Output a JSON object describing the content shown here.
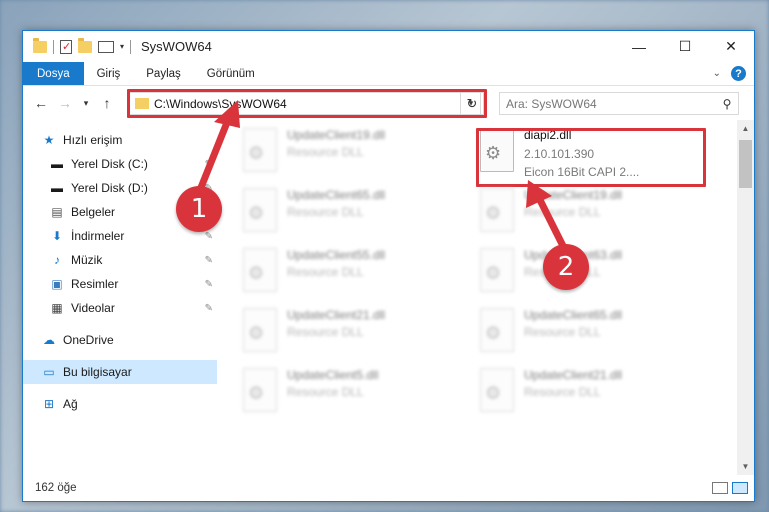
{
  "window": {
    "title": "SysWOW64",
    "controls": {
      "minimize": "—",
      "maximize": "☐",
      "close": "✕"
    }
  },
  "ribbon": {
    "tabs": [
      "Dosya",
      "Giriş",
      "Paylaş",
      "Görünüm"
    ],
    "active_tab": "Dosya"
  },
  "navigation": {
    "address_path": "C:\\Windows\\SysWOW64",
    "search_placeholder": "Ara: SysWOW64"
  },
  "sidebar": {
    "items": [
      {
        "label": "Hızlı erişim",
        "icon": "star-icon",
        "pinned": false
      },
      {
        "label": "Yerel Disk (C:)",
        "icon": "drive-icon",
        "pinned": true
      },
      {
        "label": "Yerel Disk (D:)",
        "icon": "drive-icon",
        "pinned": true
      },
      {
        "label": "Belgeler",
        "icon": "documents-icon",
        "pinned": true
      },
      {
        "label": "İndirmeler",
        "icon": "download-icon",
        "pinned": true
      },
      {
        "label": "Müzik",
        "icon": "music-icon",
        "pinned": true
      },
      {
        "label": "Resimler",
        "icon": "pictures-icon",
        "pinned": true
      },
      {
        "label": "Videolar",
        "icon": "video-icon",
        "pinned": true
      },
      {
        "label": "OneDrive",
        "icon": "cloud-icon",
        "pinned": false
      },
      {
        "label": "Bu bilgisayar",
        "icon": "computer-icon",
        "pinned": false,
        "selected": true
      },
      {
        "label": "Ağ",
        "icon": "network-icon",
        "pinned": false
      }
    ]
  },
  "files": [
    {
      "name": "UpdateClient19.dll",
      "type": "Resource DLL"
    },
    {
      "name": "diapi2.dll",
      "version": "2.10.101.390",
      "description": "Eicon 16Bit CAPI 2....",
      "highlighted": true
    },
    {
      "name": "UpdateClient65.dll",
      "type": "Resource DLL"
    },
    {
      "name": "UpdateClient19.dll",
      "type": "Resource DLL"
    },
    {
      "name": "UpdateClient55.dll",
      "type": "Resource DLL"
    },
    {
      "name": "UpdateClient63.dll",
      "type": "Resource DLL"
    },
    {
      "name": "UpdateClient21.dll",
      "type": "Resource DLL"
    },
    {
      "name": "UpdateClient65.dll",
      "type": "Resource DLL"
    },
    {
      "name": "UpdateClient5.dll",
      "type": "Resource DLL"
    },
    {
      "name": "UpdateClient21.dll",
      "type": "Resource DLL"
    }
  ],
  "status": {
    "item_count": "162 öğe"
  },
  "callouts": [
    "1",
    "2"
  ],
  "colors": {
    "accent": "#1979ca",
    "highlight_red": "#d9343c",
    "selected_bg": "#cde8ff"
  }
}
